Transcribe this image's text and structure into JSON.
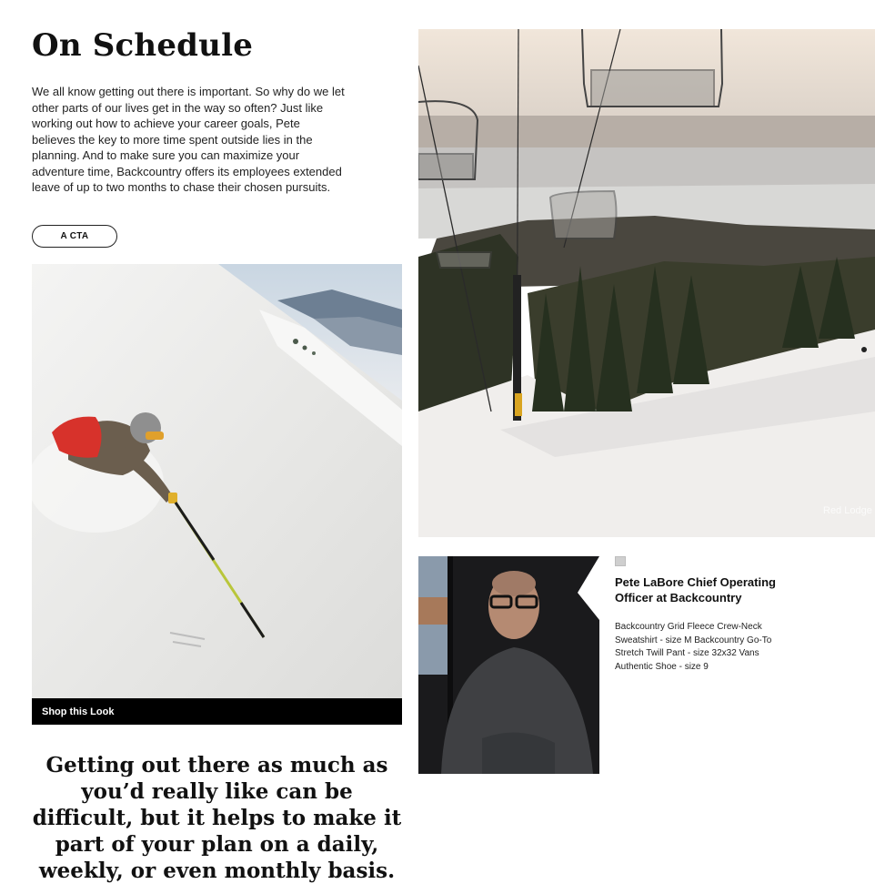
{
  "article": {
    "title": "On Schedule",
    "intro": "We all know getting out there is important. So why do we let other parts of our lives get in the way so often? Just like working out how to achieve your career goals, Pete believes the key to more time spent outside lies in the planning. And to make sure you can maximize your adventure time, Backcountry offers its employees extended leave of up to two months to chase their chosen pursuits.",
    "cta_label": "A CTA",
    "shop_label": "Shop this Look",
    "photo_watermark": "Red Lodge",
    "quote": "Getting out there as much as you’d really like can be difficult, but it helps to make it part of your plan on a daily, weekly, or even monthly basis."
  },
  "profile": {
    "name": "Pete LaBore Chief Operating Officer at Backcountry",
    "outfit": "Backcountry Grid Fleece Crew-Neck Sweatshirt - size M Backcountry Go-To Stretch Twill Pant - size 32x32 Vans Authentic Shoe - size 9"
  },
  "images": {
    "skier": "skier-in-powder-photo",
    "chairlift": "chairlift-over-ski-run-photo",
    "portrait": "portrait-photo"
  },
  "colors": {
    "shop_bar": "#000000",
    "text": "#111111",
    "background": "#ffffff"
  }
}
